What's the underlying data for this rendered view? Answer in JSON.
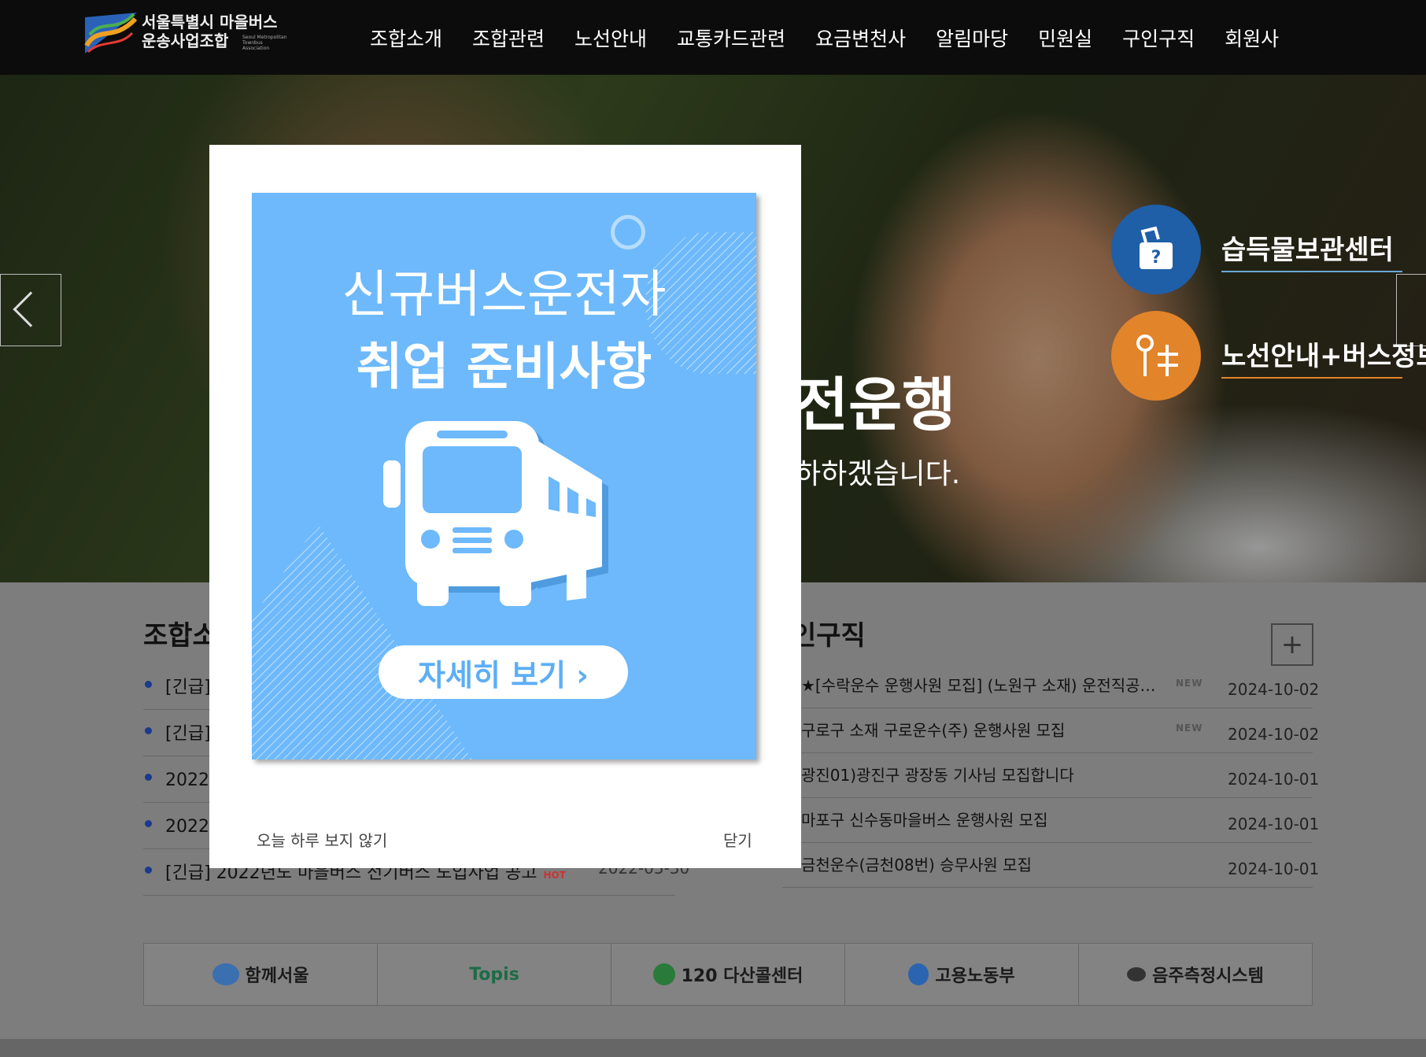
{
  "header": {
    "logo_line1": "서울특별시 마을버스",
    "logo_line2": "운송사업조합",
    "logo_en": "Seoul Metropolitan Townbus Association",
    "nav": [
      "조합소개",
      "조합관련",
      "노선안내",
      "교통카드관련",
      "요금변천사",
      "알림마당",
      "민원실",
      "구인구직",
      "회원사"
    ]
  },
  "hero": {
    "headline": "전운행",
    "sub": "하하겠습니다.",
    "quick_links": [
      {
        "label": "습득물보관센터",
        "icon": "lost-and-found-icon",
        "color": "#1f6bb6"
      },
      {
        "label": "노선안내+버스정보",
        "icon": "route-icon",
        "color": "#e8892c"
      }
    ]
  },
  "left_section": {
    "title": "조합소",
    "items": [
      {
        "text": "[긴급]",
        "date": ""
      },
      {
        "text": "[긴급]",
        "date": ""
      },
      {
        "text": "2022년",
        "date": ""
      },
      {
        "text": "2022년",
        "date": ""
      },
      {
        "text": "[긴급] 2022년도 마을버스 전기버스 도입사업 공고",
        "date": "2022-05-30",
        "badge": "HOT"
      }
    ]
  },
  "right_section": {
    "title": "인구직",
    "more_label": "+",
    "items": [
      {
        "text": "★[수락운수 운행사원 모집] (노원구 소재) 운전직공무원 준…",
        "date": "2024-10-02",
        "badge": "NEW"
      },
      {
        "text": "구로구 소재 구로운수(주) 운행사원 모집",
        "date": "2024-10-02",
        "badge": "NEW"
      },
      {
        "text": "광진01)광진구 광장동 기사님 모집합니다",
        "date": "2024-10-01",
        "badge": ""
      },
      {
        "text": "마포구 신수동마을버스 운행사원 모집",
        "date": "2024-10-01",
        "badge": ""
      },
      {
        "text": "금천운수(금천08번) 승무사원 모집",
        "date": "2024-10-01",
        "badge": ""
      }
    ]
  },
  "banners": [
    {
      "label": "함께서울",
      "color": "#3a6fb0"
    },
    {
      "label": "Topis",
      "color": "#2d8a5a"
    },
    {
      "label": "120 다산콜센터",
      "color": "#2a7a3a"
    },
    {
      "label": "고용노동부",
      "color": "#2b64b0"
    },
    {
      "label": "음주측정시스템",
      "color": "#333333"
    }
  ],
  "popup": {
    "line1": "신규버스운전자",
    "line2": "취업 준비사항",
    "button": "자세히 보기 ›",
    "dont_show_today": "오늘 하루 보지 않기",
    "close": "닫기"
  }
}
